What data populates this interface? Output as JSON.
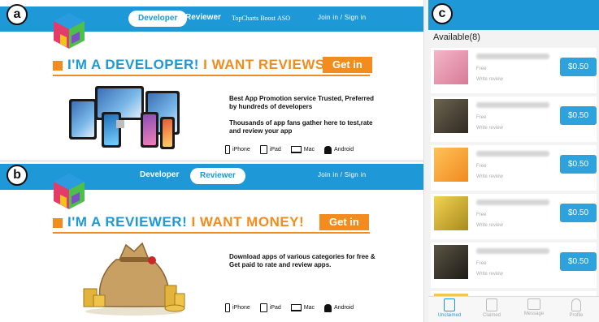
{
  "panels": {
    "a": {
      "badge": "a",
      "nav": {
        "developer": "Developer",
        "reviewer": "Reviewer",
        "topcharts": "TopCharts Boost",
        "aso": "ASO",
        "join": "Join in  /  Sign in"
      },
      "headline_blue": "I'M A DEVELOPER!",
      "headline_orange": "I WANT REVIEWS!",
      "cta": "Get in",
      "desc1": "Best App Promotion service Trusted, Preferred by hundreds of developers",
      "desc2": "Thousands of app fans gather here to test,rate and review your app"
    },
    "b": {
      "badge": "b",
      "nav": {
        "developer": "Developer",
        "reviewer": "Reviewer",
        "join": "Join in  /  Sign in"
      },
      "headline_blue": "I'M A REVIEWER!",
      "headline_orange": "I WANT MONEY!",
      "cta": "Get in",
      "desc1": "Download apps of various categories for free & Get paid to rate and review apps."
    },
    "platforms": [
      "iPhone",
      "iPad",
      "Mac",
      "Android"
    ]
  },
  "phone": {
    "badge": "c",
    "available": "Available(8)",
    "items": [
      {
        "free": "Free",
        "write": "Write review",
        "price": "$0.50",
        "thumb_color": "#e7a0b4"
      },
      {
        "free": "Free",
        "write": "Write review",
        "price": "$0.50",
        "thumb_color": "#4f4638"
      },
      {
        "free": "Free",
        "write": "Write review",
        "price": "$0.50",
        "thumb_color": "#f4a43a"
      },
      {
        "free": "Free",
        "write": "Write review",
        "price": "$0.50",
        "thumb_color": "#d9b73a"
      },
      {
        "free": "Free",
        "write": "Write review",
        "price": "$0.50",
        "thumb_color": "#3f3a30"
      }
    ],
    "tabs": [
      "Unclaimed",
      "Claimed",
      "Message",
      "Profile"
    ]
  },
  "colors": {
    "brand_blue": "#1e98d6",
    "accent_orange": "#f28c1e"
  }
}
